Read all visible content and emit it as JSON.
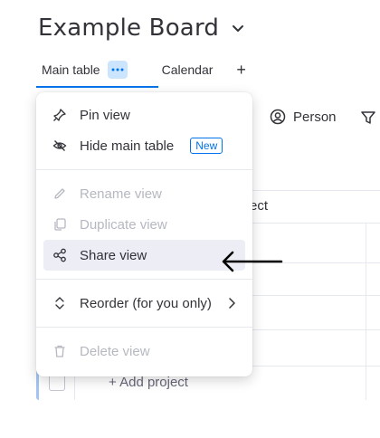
{
  "board": {
    "title": "Example Board"
  },
  "tabs": {
    "main": "Main table",
    "calendar": "Calendar",
    "add": "+"
  },
  "toolbar": {
    "person": "Person"
  },
  "table": {
    "project_header": "ect",
    "add_project": "+ Add project"
  },
  "menu": {
    "items": [
      {
        "label": "Pin view",
        "icon": "pin-icon",
        "enabled": true
      },
      {
        "label": "Hide main table",
        "icon": "eye-slash-icon",
        "enabled": true,
        "badge": "New"
      },
      {
        "label": "Rename view",
        "icon": "pencil-icon",
        "enabled": false
      },
      {
        "label": "Duplicate view",
        "icon": "duplicate-icon",
        "enabled": false
      },
      {
        "label": "Share view",
        "icon": "share-icon",
        "enabled": true,
        "hovered": true
      },
      {
        "label": "Reorder (for you only)",
        "icon": "reorder-icon",
        "enabled": true,
        "submenu": true
      },
      {
        "label": "Delete view",
        "icon": "trash-icon",
        "enabled": false
      }
    ]
  },
  "colors": {
    "accent": "#0073ea",
    "tab_menu_bg": "#cce5ff",
    "hover_bg": "#ecedf5",
    "disabled_text": "#b6b8c1"
  }
}
